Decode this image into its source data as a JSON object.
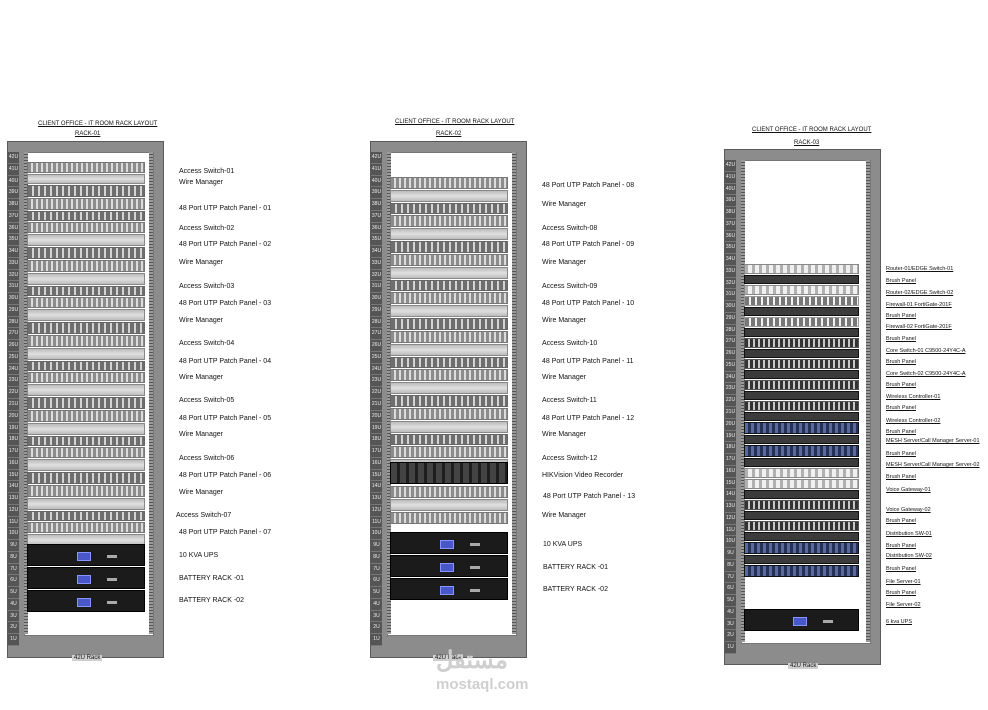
{
  "racks": [
    {
      "title": "CLIENT OFFICE - IT ROOM RACK LAYOUT",
      "name": "RACK-01",
      "caption": "42U Rack",
      "units": [
        "42U",
        "41U",
        "40U",
        "39U",
        "38U",
        "37U",
        "36U",
        "35U",
        "34U",
        "33U",
        "32U",
        "31U",
        "30U",
        "29U",
        "28U",
        "27U",
        "26U",
        "25U",
        "24U",
        "23U",
        "22U",
        "21U",
        "20U",
        "19U",
        "18U",
        "17U",
        "16U",
        "15U",
        "14U",
        "13U",
        "12U",
        "11U",
        "10U",
        "9U",
        "8U",
        "7U",
        "6U",
        "5U",
        "4U",
        "3U",
        "2U",
        "1U"
      ],
      "labels": [
        "Access Switch-01",
        "Wire Manager",
        "48 Port UTP Patch Panel - 01",
        "Access Switch-02",
        "48 Port UTP Patch Panel - 02",
        "Wire Manager",
        "Access Switch-03",
        "48 Port UTP Patch Panel - 03",
        "Wire Manager",
        "Access Switch-04",
        "48 Port UTP Patch Panel - 04",
        "Wire Manager",
        "Access Switch-05",
        "48 Port UTP Patch Panel - 05",
        "Wire Manager",
        "Access Switch-06",
        "48 Port UTP Patch Panel - 06",
        "Wire Manager",
        "Access Switch-07",
        "48 Port UTP Patch Panel - 07",
        "10 KVA UPS",
        "BATTERY RACK -01",
        "BATTERY RACK -02"
      ]
    },
    {
      "title": "CLIENT OFFICE - IT ROOM RACK LAYOUT",
      "name": "RACK-02",
      "caption": "42U Rack",
      "units": [
        "42U",
        "41U",
        "40U",
        "39U",
        "38U",
        "37U",
        "36U",
        "35U",
        "34U",
        "33U",
        "32U",
        "31U",
        "30U",
        "29U",
        "28U",
        "27U",
        "26U",
        "25U",
        "24U",
        "23U",
        "22U",
        "21U",
        "20U",
        "19U",
        "18U",
        "17U",
        "16U",
        "15U",
        "14U",
        "13U",
        "12U",
        "11U",
        "10U",
        "9U",
        "8U",
        "7U",
        "6U",
        "5U",
        "4U",
        "3U",
        "2U",
        "1U"
      ],
      "labels": [
        "48 Port UTP Patch Panel - 08",
        "Wire Manager",
        "Access Switch-08",
        "48 Port UTP Patch Panel - 09",
        "Wire Manager",
        "Access Switch-09",
        "48 Port UTP Patch Panel - 10",
        "Wire Manager",
        "Access Switch-10",
        "48 Port UTP Patch Panel - 11",
        "Wire Manager",
        "Access Switch-11",
        "48 Port UTP Patch Panel - 12",
        "Wire Manager",
        "Access Switch-12",
        "HIKVision Video Recorder",
        "48 Port UTP Patch Panel - 13",
        "Wire Manager",
        "10 KVA UPS",
        "BATTERY RACK -01",
        "BATTERY RACK -02"
      ]
    },
    {
      "title": "CLIENT OFFICE - IT ROOM RACK LAYOUT",
      "name": "RACK-03",
      "caption": "42U Rack",
      "units": [
        "42U",
        "41U",
        "40U",
        "39U",
        "38U",
        "37U",
        "36U",
        "35U",
        "34U",
        "33U",
        "32U",
        "31U",
        "30U",
        "29U",
        "28U",
        "27U",
        "26U",
        "25U",
        "24U",
        "23U",
        "22U",
        "21U",
        "20U",
        "19U",
        "18U",
        "17U",
        "16U",
        "15U",
        "14U",
        "13U",
        "12U",
        "11U",
        "10U",
        "9U",
        "8U",
        "7U",
        "6U",
        "5U",
        "4U",
        "3U",
        "2U",
        "1U"
      ],
      "labels": [
        "Router-01/EDGE Switch-01",
        "Brush Panel",
        "Router-02/EDGE Switch-02",
        "Firewall-01 FortiGate-201F",
        "Brush Panel",
        "Firewall-02 FortiGate-201F",
        "Brush Panel",
        "Core Switch-01 C9500-24Y4C-A",
        "Brush Panel",
        "Core Switch-02 C9500-24Y4C-A",
        "Brush Panel",
        "Wireless Controller-01",
        "Brush Panel",
        "Wireless Controller-02",
        "Brush Panel",
        "MESH Server/Call Manager Server-01",
        "Brush Panel",
        "MESH Server/Call Manager Server-02",
        "Brush Panel",
        "Voice Gateway-01",
        "Voice Gateway-02",
        "Brush Panel",
        "Distribution SW-01",
        "Brush Panel",
        "Distribution SW-02",
        "Brush Panel",
        "File Server-01",
        "Brush Panel",
        "File Server-02",
        "6 kva UPS"
      ]
    }
  ],
  "watermark": {
    "arabic": "مستقل",
    "latin": "mostaql.com"
  },
  "colors": {
    "rack_frame": "#8c8c8c",
    "ups_screen": "#4a57c8",
    "server": "#2f3f6a"
  }
}
